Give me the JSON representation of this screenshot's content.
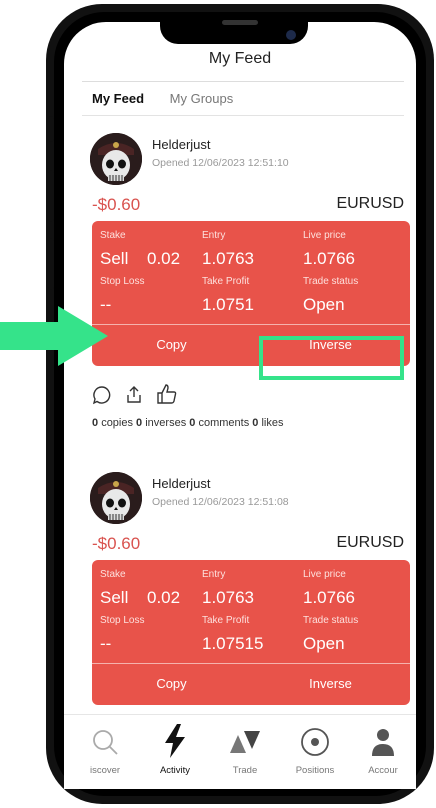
{
  "header": {
    "title": "My Feed"
  },
  "tabs": [
    {
      "label": "My Feed",
      "active": true
    },
    {
      "label": "My Groups",
      "active": false
    }
  ],
  "posts": [
    {
      "username": "Helderjust",
      "opened": "Opened 12/06/2023 12:51:10",
      "pnl": "-$0.60",
      "pair": "EURUSD",
      "stake_label": "Stake",
      "stake_side": "Sell",
      "stake_amount": "0.02",
      "entry_label": "Entry",
      "entry_value": "1.0763",
      "live_label": "Live price",
      "live_value": "1.0766",
      "sl_label": "Stop Loss",
      "sl_value": "--",
      "tp_label": "Take Profit",
      "tp_value": "1.0751",
      "status_label": "Trade status",
      "status_value": "Open",
      "copy_label": "Copy",
      "inverse_label": "Inverse",
      "counts": {
        "copies": "0",
        "copies_label": "copies",
        "inverses": "0",
        "inverses_label": "inverses",
        "comments": "0",
        "comments_label": "comments",
        "likes": "0",
        "likes_label": "likes"
      }
    },
    {
      "username": "Helderjust",
      "opened": "Opened 12/06/2023 12:51:08",
      "pnl": "-$0.60",
      "pair": "EURUSD",
      "stake_label": "Stake",
      "stake_side": "Sell",
      "stake_amount": "0.02",
      "entry_label": "Entry",
      "entry_value": "1.0763",
      "live_label": "Live price",
      "live_value": "1.0766",
      "sl_label": "Stop Loss",
      "sl_value": "--",
      "tp_label": "Take Profit",
      "tp_value": "1.07515",
      "status_label": "Trade status",
      "status_value": "Open",
      "copy_label": "Copy",
      "inverse_label": "Inverse"
    }
  ],
  "tabbar": [
    {
      "label": "iscover",
      "icon": "search-icon"
    },
    {
      "label": "Activity",
      "icon": "lightning-icon",
      "active": true
    },
    {
      "label": "Trade",
      "icon": "trade-arrows-icon"
    },
    {
      "label": "Positions",
      "icon": "target-icon"
    },
    {
      "label": "Accour",
      "icon": "account-icon"
    }
  ],
  "colors": {
    "card": "#e8534a",
    "negative": "#d9534f",
    "highlight": "#35e38a"
  }
}
